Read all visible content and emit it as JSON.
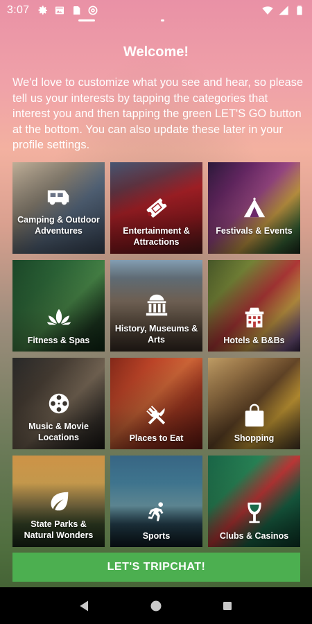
{
  "status_bar": {
    "time": "3:07",
    "left_icons": [
      "gear-icon",
      "image-icon",
      "sim-card-icon",
      "at-sign-icon"
    ],
    "right_icons": [
      "wifi-icon",
      "cellular-signal-icon",
      "battery-icon"
    ]
  },
  "header": {
    "title": "Welcome!",
    "intro": "We'd love to customize what you see and hear, so please tell us your interests by tapping the categories that interest you and then tapping the green LET'S GO button at the bottom. You can also update these later in your profile settings."
  },
  "categories": [
    {
      "label": "Camping & Outdoor Adventures",
      "icon": "rv-camper-icon"
    },
    {
      "label": "Entertainment & Attractions",
      "icon": "ticket-icon"
    },
    {
      "label": "Festivals & Events",
      "icon": "tent-icon"
    },
    {
      "label": "Fitness & Spas",
      "icon": "lotus-icon"
    },
    {
      "label": "History, Museums & Arts",
      "icon": "museum-icon"
    },
    {
      "label": "Hotels & B&Bs",
      "icon": "hotel-icon"
    },
    {
      "label": "Music & Movie Locations",
      "icon": "film-reel-icon"
    },
    {
      "label": "Places to Eat",
      "icon": "fork-knife-icon"
    },
    {
      "label": "Shopping",
      "icon": "shopping-bag-icon"
    },
    {
      "label": "State Parks & Natural Wonders",
      "icon": "leaf-icon"
    },
    {
      "label": "Sports",
      "icon": "runner-icon"
    },
    {
      "label": "Clubs & Casinos",
      "icon": "wine-glass-icon"
    }
  ],
  "cta": {
    "label": "LET'S TRIPCHAT!",
    "color": "#4caf50"
  },
  "nav": {
    "icons": [
      "back-icon",
      "home-icon",
      "recents-icon"
    ]
  }
}
